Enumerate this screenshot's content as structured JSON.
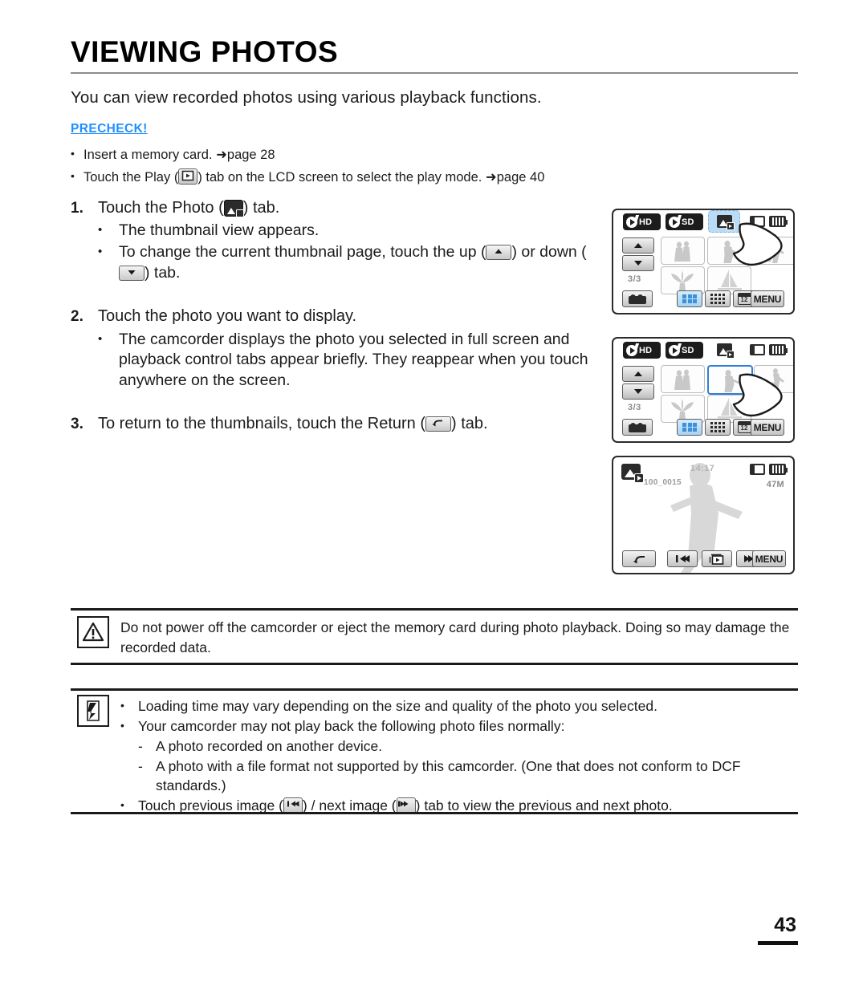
{
  "document": {
    "title": "VIEWING PHOTOS",
    "intro": "You can view recorded photos using various playback functions.",
    "page_number": "43"
  },
  "precheck": {
    "label": "PRECHECK!",
    "color": "#1e8fff",
    "items": [
      {
        "bullet": "•",
        "text_before": "Insert a memory card. ",
        "arrow": "➜",
        "text_after": "page 28"
      },
      {
        "bullet": "•",
        "text_before": "Touch the Play (",
        "icon": "play-icon",
        "text_mid": ") tab on the LCD screen to select the play mode. ",
        "arrow": "➜",
        "text_after": "page 40"
      }
    ]
  },
  "steps": [
    {
      "num": "1.",
      "text_before": "Touch the Photo (",
      "icon": "photo-tab-icon",
      "text_after": ") tab.",
      "subs": [
        {
          "bullet": "•",
          "text": "The thumbnail view appears."
        },
        {
          "bullet": "•",
          "text_before": "To change the current thumbnail page, touch the up (",
          "icon1": "up-arrow-icon",
          "text_mid": ") or down (",
          "icon2": "down-arrow-icon",
          "text_after": ") tab."
        }
      ]
    },
    {
      "num": "2.",
      "text_before": "Touch the photo you want to display.",
      "subs": [
        {
          "bullet": "•",
          "text": "The camcorder displays the photo you selected in full screen and playback control tabs appear briefly. They reappear when you touch anywhere on the screen."
        }
      ]
    },
    {
      "num": "3.",
      "text_before": "To return to the thumbnails, touch the Return (",
      "icon": "return-icon",
      "text_after": ") tab.",
      "subs": []
    }
  ],
  "lcd_screens": [
    {
      "id": "thumbnail-view-tab-highlight",
      "mode_tabs": [
        {
          "name": "play-hd-tab",
          "label": "HD"
        },
        {
          "name": "play-sd-tab",
          "label": "SD"
        }
      ],
      "photo_tab": {
        "name": "photo-tab",
        "state": "active-highlighted"
      },
      "nav": {
        "up": "▲",
        "down": "▼",
        "page_indicator": "3/3"
      },
      "view_modes": [
        {
          "name": "grid-3x2-view",
          "selected": true
        },
        {
          "name": "grid-4x3-view",
          "selected": false
        },
        {
          "name": "calendar-view",
          "label": "12",
          "selected": false
        }
      ],
      "menu_label": "MENU",
      "video_tab": "video-mode-button",
      "thumbnails": [
        "couple",
        "dancer",
        "runner",
        "plant",
        "sailboat"
      ],
      "selected_thumbnail": null,
      "hand_cursor": true
    },
    {
      "id": "thumbnail-view-photo-selected",
      "mode_tabs": [
        {
          "name": "play-hd-tab",
          "label": "HD"
        },
        {
          "name": "play-sd-tab",
          "label": "SD"
        }
      ],
      "photo_tab": {
        "name": "photo-tab",
        "state": "plain"
      },
      "nav": {
        "up": "▲",
        "down": "▼",
        "page_indicator": "3/3"
      },
      "view_modes": [
        {
          "name": "grid-3x2-view",
          "selected": true
        },
        {
          "name": "grid-4x3-view",
          "selected": false
        },
        {
          "name": "calendar-view",
          "label": "12",
          "selected": false
        }
      ],
      "menu_label": "MENU",
      "video_tab": "video-mode-button",
      "thumbnails": [
        "couple",
        "dancer",
        "runner",
        "plant",
        "sailboat"
      ],
      "selected_thumbnail": "dancer",
      "hand_cursor": true
    },
    {
      "id": "full-screen-photo-playback",
      "osd": {
        "photo_mode_icon": "photo-playback-icon",
        "file_name": "100_0015",
        "time": "14:17",
        "size": "47M"
      },
      "controls": [
        {
          "name": "return-button",
          "icon": "return-arrow"
        },
        {
          "name": "previous-image-button",
          "icon": "skip-back"
        },
        {
          "name": "slideshow-button",
          "icon": "slideshow"
        },
        {
          "name": "next-image-button",
          "icon": "skip-forward"
        },
        {
          "name": "menu-button",
          "label": "MENU"
        }
      ]
    }
  ],
  "caution": {
    "icon": "warning-triangle-icon",
    "text": "Do not power off the camcorder or eject the memory card during photo playback. Doing so may damage the recorded data."
  },
  "notes": {
    "icon": "note-pencil-icon",
    "items": [
      {
        "bullet": "•",
        "text": "Loading time may vary depending on the size and quality of the photo you selected."
      },
      {
        "bullet": "•",
        "text": "Your camcorder may not play back the following photo files normally:"
      },
      {
        "dash": "-",
        "text": "A photo recorded on another device."
      },
      {
        "dash": "-",
        "text": "A photo with a file format not supported by this camcorder. (One that does not conform to DCF standards.)"
      },
      {
        "bullet": "•",
        "text_before": "Touch previous image (",
        "icon1": "skip-back-icon",
        "text_mid": ") / next image (",
        "icon2": "skip-forward-icon",
        "text_after": ") tab to view the previous and next photo."
      }
    ]
  }
}
